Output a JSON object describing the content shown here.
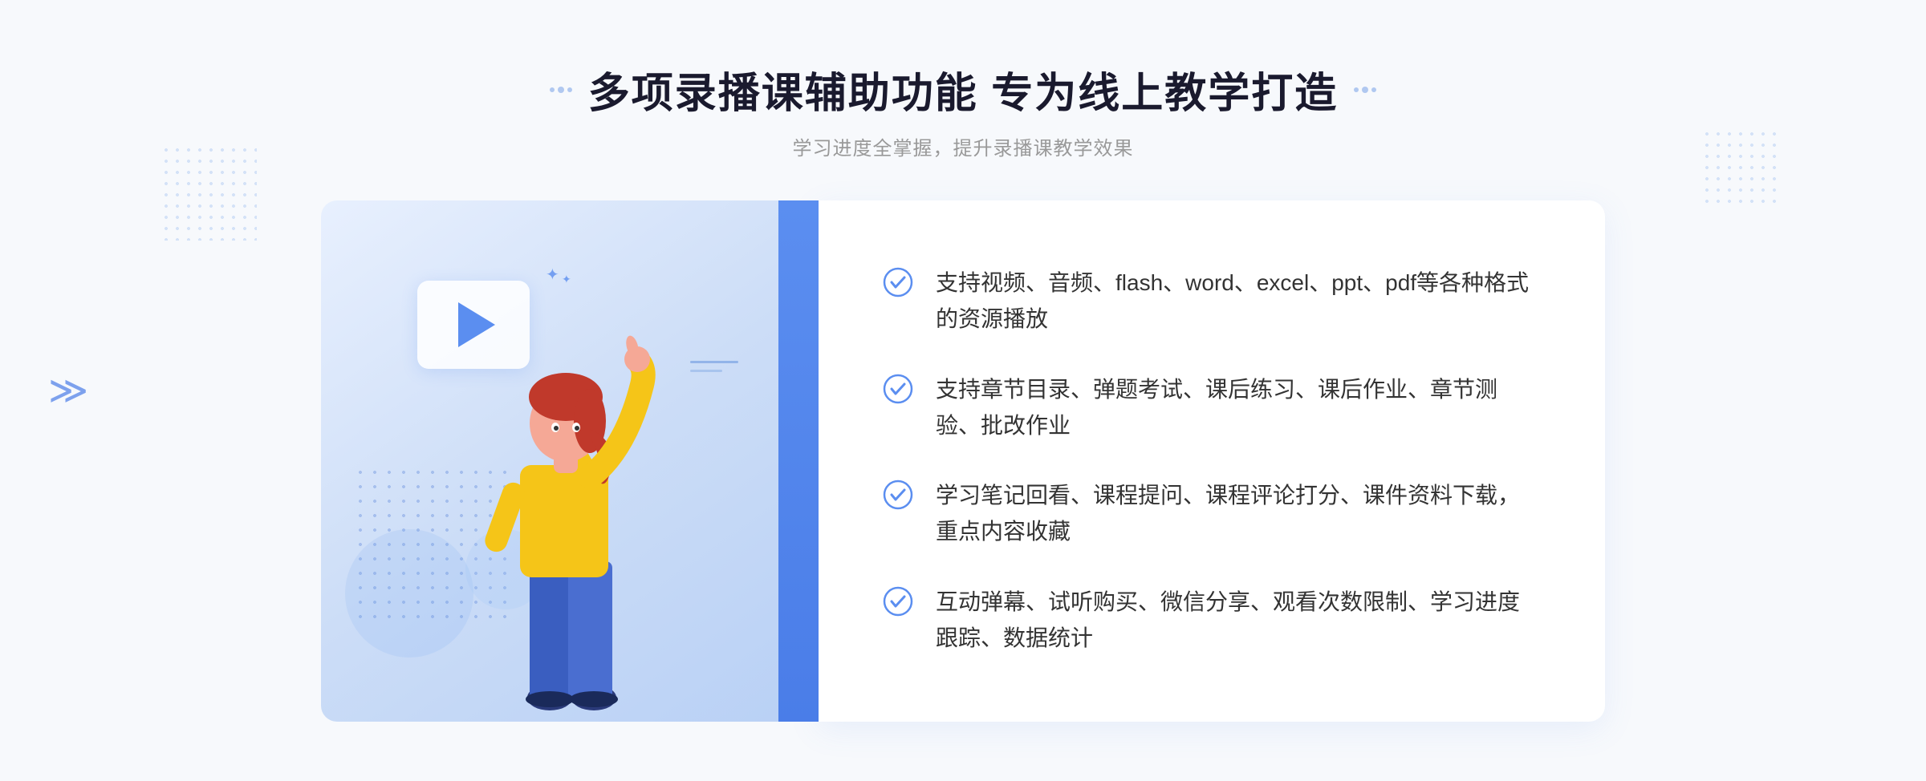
{
  "header": {
    "title": "多项录播课辅助功能 专为线上教学打造",
    "subtitle": "学习进度全掌握，提升录播课教学效果",
    "title_dots_left": [
      "·",
      "·",
      "·"
    ],
    "title_dots_right": [
      "·",
      "·",
      "·"
    ]
  },
  "features": [
    {
      "id": 1,
      "text": "支持视频、音频、flash、word、excel、ppt、pdf等各种格式的资源播放"
    },
    {
      "id": 2,
      "text": "支持章节目录、弹题考试、课后练习、课后作业、章节测验、批改作业"
    },
    {
      "id": 3,
      "text": "学习笔记回看、课程提问、课程评论打分、课件资料下载，重点内容收藏"
    },
    {
      "id": 4,
      "text": "互动弹幕、试听购买、微信分享、观看次数限制、学习进度跟踪、数据统计"
    }
  ],
  "illustration": {
    "play_button_alt": "play button"
  },
  "colors": {
    "primary_blue": "#4a7de8",
    "light_blue": "#e8f0fe",
    "text_dark": "#1a1a2e",
    "text_gray": "#999999",
    "check_color": "#5b8ef0"
  }
}
